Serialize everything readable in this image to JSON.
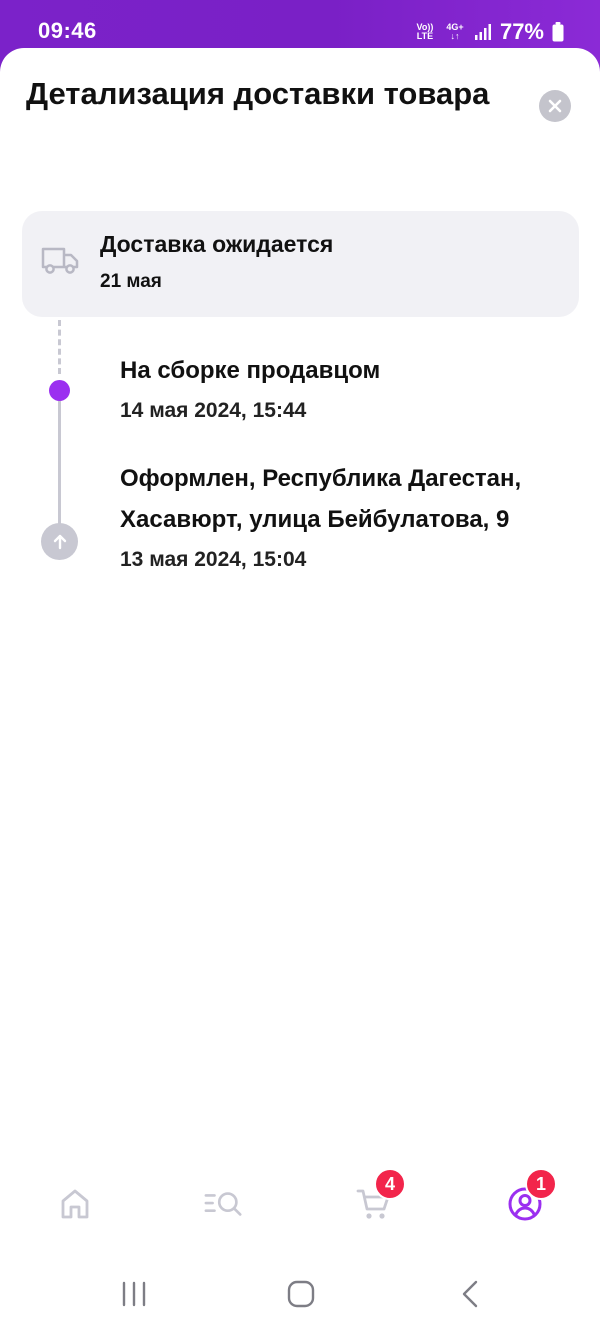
{
  "status_bar": {
    "time": "09:46",
    "network_top": "Vo))",
    "network_bottom": "LTE",
    "signal_type_top": "4G+",
    "signal_type_bottom": "↓↑",
    "battery": "77%"
  },
  "sheet": {
    "title": "Детализация доставки товара"
  },
  "delivery": {
    "title": "Доставка ожидается",
    "date": "21 мая",
    "icon": "truck-icon"
  },
  "events": [
    {
      "title": "На сборке продавцом",
      "time": "14 мая 2024, 15:44"
    },
    {
      "title": "Оформлен, Республика Дагестан, Хасавюрт, улица Бейбулатова, 9",
      "time": "13 мая 2024, 15:04"
    }
  ],
  "bottom_nav": {
    "cart_badge": "4",
    "profile_badge": "1"
  },
  "colors": {
    "accent": "#9b2ff0",
    "status_bar": "#7a20c6",
    "badge": "#f2254b",
    "inactive_icon": "#c8c8d2"
  }
}
